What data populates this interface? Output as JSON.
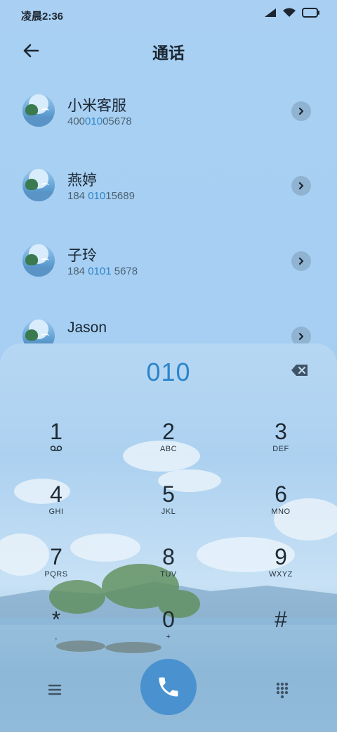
{
  "status": {
    "time": "凌晨2:36"
  },
  "header": {
    "title": "通话"
  },
  "contacts": [
    {
      "name": "小米客服",
      "num_pre": "400",
      "num_hl": "010",
      "num_post": "05678"
    },
    {
      "name": "燕婷",
      "num_pre": "184 ",
      "num_hl": "010",
      "num_post": "15689"
    },
    {
      "name": "子玲",
      "num_pre": "184 ",
      "num_hl": "0101",
      "num_post": " 5678"
    },
    {
      "name": "Jason",
      "num_pre": "",
      "num_hl": "",
      "num_post": ""
    }
  ],
  "dialer": {
    "entry": "010",
    "keys": [
      {
        "digit": "1",
        "letters": "voicemail-icon"
      },
      {
        "digit": "2",
        "letters": "ABC"
      },
      {
        "digit": "3",
        "letters": "DEF"
      },
      {
        "digit": "4",
        "letters": "GHI"
      },
      {
        "digit": "5",
        "letters": "JKL"
      },
      {
        "digit": "6",
        "letters": "MNO"
      },
      {
        "digit": "7",
        "letters": "PQRS"
      },
      {
        "digit": "8",
        "letters": "TUV"
      },
      {
        "digit": "9",
        "letters": "WXYZ"
      },
      {
        "digit": "*",
        "letters": ","
      },
      {
        "digit": "0",
        "letters": "+"
      },
      {
        "digit": "#",
        "letters": ""
      }
    ]
  },
  "colors": {
    "accent": "#2b84cc",
    "call_button": "#4a92cf"
  }
}
